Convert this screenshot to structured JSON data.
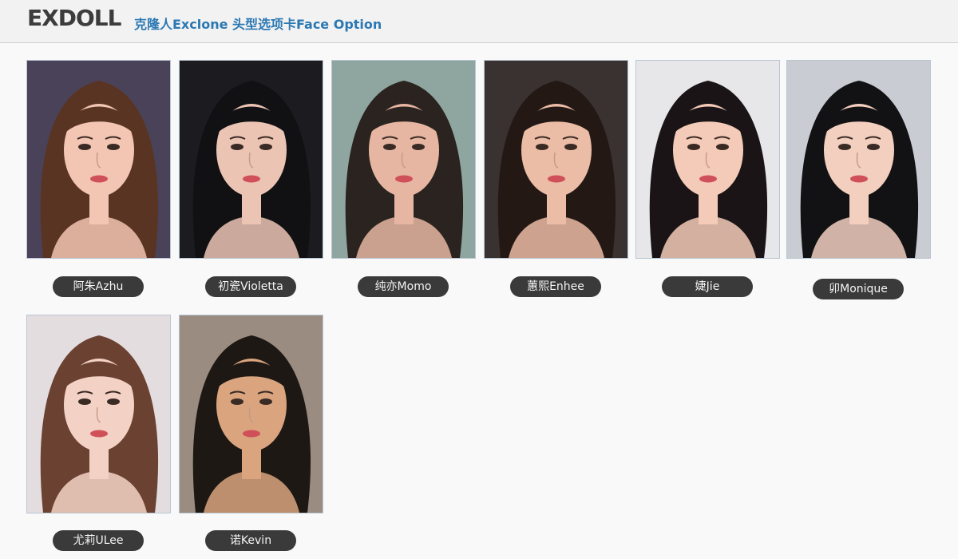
{
  "header": {
    "brand": "EXDOLL",
    "subtitle": "克隆人Exclone 头型选项卡Face Option"
  },
  "faces": [
    {
      "name": "阿朱Azhu",
      "bg": "#4a4258",
      "skin": "#f2c6b2",
      "hair": "#5a3422",
      "icon": "face-portrait-icon"
    },
    {
      "name": "初瓷Violetta",
      "bg": "#1c1c20",
      "skin": "#ecc4b4",
      "hair": "#111114",
      "icon": "face-portrait-icon"
    },
    {
      "name": "纯亦Momo",
      "bg": "#8fa6a0",
      "skin": "#e6b6a2",
      "hair": "#2b231f",
      "icon": "face-portrait-icon"
    },
    {
      "name": "蕙熙Enhee",
      "bg": "#3a3230",
      "skin": "#ebbca6",
      "hair": "#241815",
      "icon": "face-portrait-icon"
    },
    {
      "name": "婕Jie",
      "bg": "#e7e7ea",
      "skin": "#f4cbb8",
      "hair": "#1a1416",
      "icon": "face-portrait-icon"
    },
    {
      "name": "卯Monique",
      "bg": "#c9cdd3",
      "skin": "#f2cfbf",
      "hair": "#121214",
      "icon": "face-portrait-icon"
    },
    {
      "name": "尤莉ULee",
      "bg": "#e4dde0",
      "skin": "#f3d2c5",
      "hair": "#6b4232",
      "icon": "face-portrait-icon"
    },
    {
      "name": "诺Kevin",
      "bg": "#9a8c80",
      "skin": "#d9a47e",
      "hair": "#1e1814",
      "icon": "face-portrait-icon"
    }
  ]
}
